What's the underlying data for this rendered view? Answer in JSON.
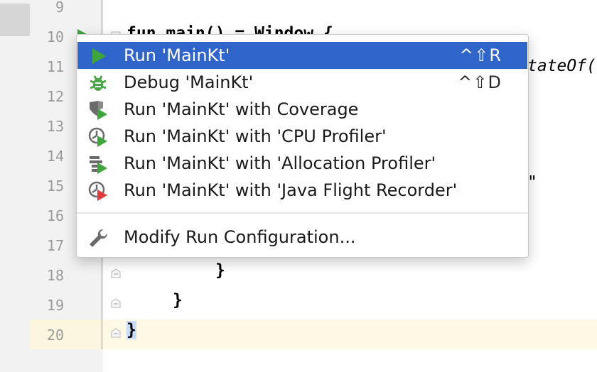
{
  "editor": {
    "line_numbers": [
      "9",
      "10",
      "11",
      "12",
      "13",
      "14",
      "15",
      "16",
      "17",
      "18",
      "19",
      "20"
    ],
    "code_fragments": {
      "line10": "fun main() = Window {",
      "line11_tail": "tateOf(",
      "line15_tail": "\"",
      "line18": "}",
      "line19": "}",
      "line20": "}"
    }
  },
  "popup": {
    "items": [
      {
        "label": "Run 'MainKt'",
        "shortcut": "^⇧R",
        "icon": "run-icon",
        "selected": true
      },
      {
        "label": "Debug 'MainKt'",
        "shortcut": "^⇧D",
        "icon": "debug-icon",
        "selected": false
      },
      {
        "label": "Run 'MainKt' with Coverage",
        "shortcut": "",
        "icon": "coverage-icon",
        "selected": false
      },
      {
        "label": "Run 'MainKt' with 'CPU Profiler'",
        "shortcut": "",
        "icon": "cpu-profiler-icon",
        "selected": false
      },
      {
        "label": "Run 'MainKt' with 'Allocation Profiler'",
        "shortcut": "",
        "icon": "allocation-profiler-icon",
        "selected": false
      },
      {
        "label": "Run 'MainKt' with 'Java Flight Recorder'",
        "shortcut": "",
        "icon": "flight-recorder-icon",
        "selected": false
      }
    ],
    "footer_item": {
      "label": "Modify Run Configuration...",
      "icon": "wrench-icon"
    }
  },
  "colors": {
    "selection": "#2f65ca",
    "run_green": "#3ea53a",
    "recorder_red": "#e23b3b",
    "gutter_bg": "#f2f2f2",
    "current_line": "#fdf9e5"
  }
}
